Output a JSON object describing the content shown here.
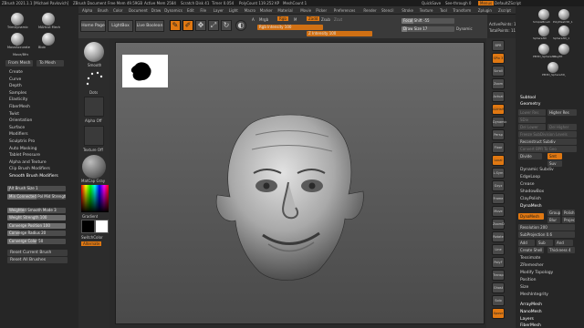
{
  "titlebar": {
    "app": "ZBrush 2021.1.1 [Michael Pavlovich]",
    "doc": "ZBrush Document",
    "mem1": "Free Mem 49.59GB",
    "mem2": "Active Mem 2584",
    "scratch": "Scratch Disk 41",
    "timer": "Timer 0.054",
    "polycount": "PolyCount 119.252 KP",
    "meshcount": "MeshCount 1",
    "quicksave": "QuickSave",
    "seethrough": "See-through 0",
    "menus": "Menus",
    "defaultscript": "DefaultZScript"
  },
  "menubar": [
    "Alpha",
    "Brush",
    "Color",
    "Document",
    "Draw",
    "Dynamics",
    "Edit",
    "File",
    "Layer",
    "Light",
    "Macro",
    "Marker",
    "Material",
    "Movie",
    "Picker",
    "Preferences",
    "Render",
    "Stencil",
    "Stroke",
    "Texture",
    "Tool",
    "Transform",
    "Zplugin",
    "Zscript",
    "Help"
  ],
  "toolbar": {
    "home": "Home Page",
    "lightbox": "LightBox",
    "liveboolean": "Live Boolean",
    "edit": "Edit",
    "draw": "Draw",
    "move": "Move",
    "scale": "Scale",
    "rotate": "Rotate",
    "a_label": "A",
    "mrgb": "Mrgb",
    "rgb": "Rgb",
    "m_label": "M",
    "zadd": "Zadd",
    "zsub": "Zsub",
    "zcut": "Zcut",
    "rgb_intensity": "Rgb Intensity 100",
    "z_intensity": "Z Intensity 100",
    "rgb_intensity_value": 1.0,
    "z_intensity_value": 1.0,
    "focal_shift": "Focal Shift -55",
    "draw_size": "Draw Size 17",
    "dynamic": "Dynamic",
    "focal_shift_value": 0.225,
    "draw_size_value": 0.1,
    "active_points": "ActivePoints: 119",
    "total_points": "TotalPoints: 119"
  },
  "leftpanel": {
    "spheres": [
      {
        "label": "TrimDynamic"
      },
      {
        "label": "MAHcut Mech"
      },
      {
        "label": "MoveAccurate"
      },
      {
        "label": "Blob"
      },
      {
        "label": "Move/Bfrs"
      }
    ],
    "from_mesh": "From Mesh",
    "to_mesh": "To Mesh",
    "items": [
      "Create",
      "Curve",
      "Depth",
      "Samples",
      "Elasticity",
      "FiberMesh",
      "Twist",
      "Orientation",
      "Surface",
      "Modifiers",
      "Sculptris Pro",
      "Auto Masking",
      "Tablet Pressure",
      "Alpha and Texture",
      "Clip Brush Modifiers",
      "Smooth Brush Modifiers"
    ],
    "sliders": [
      {
        "label": "Alt Brush Size 1",
        "value": 0.05
      },
      {
        "label": "Min Connected Pol Mid Strength",
        "value": 0.5
      },
      {
        "label": "Weighted Smooth Mode 3",
        "value": 0.3
      },
      {
        "label": "Weight Strength 100",
        "value": 1.0
      },
      {
        "label": "Converge Position 100",
        "value": 1.0
      },
      {
        "label": "Converge Radius 20",
        "value": 0.2
      },
      {
        "label": "Converge Color 50",
        "value": 0.5
      }
    ],
    "reset_current": "Reset Current Brush",
    "reset_all": "Reset All Brushes"
  },
  "brushcol": {
    "smooth": "Smooth",
    "dots": "Dots",
    "alpha_off": "Alpha Off",
    "texture_off": "Texture Off",
    "matcap": "MatCap Gray",
    "gradient": "Gradient",
    "switchcolor": "SwitchColor",
    "alternate": "Alternate"
  },
  "rightcol": [
    "BPR",
    "SPix 3",
    "Scroll",
    "Zoom",
    "Actual",
    "AAHalf",
    "Dynamic",
    "Persp",
    "Floor",
    "Local",
    "L.Sym",
    "Gxyz",
    "Frame",
    "Move",
    "ZoomD",
    "Rotate",
    "Line Fill",
    "PolyF",
    "Transp",
    "Ghost",
    "Solo",
    "Xpose"
  ],
  "rightpanel": {
    "tools": [
      {
        "label": "SimpleBrush"
      },
      {
        "label": "PolyMesh3D_1"
      },
      {
        "label": "Sphere3D"
      },
      {
        "label": "Sphere3D_1"
      },
      {
        "label": "PM3D_Sphere3D"
      },
      {
        "label": "ClayPit"
      },
      {
        "label": "PM3D_Sphere3D_1"
      }
    ],
    "subtool": "Subtool",
    "geometry": "Geometry",
    "lower_res": "Lower Res",
    "higher_res": "Higher Res",
    "sdiv": "SDiv",
    "del_lower": "Del Lower",
    "del_higher": "Del Higher",
    "freeze": "Freeze SubDivision Levels",
    "reconstruct": "Reconstruct Subdiv",
    "convert": "Convert BPR To Geo",
    "divide": "Divide",
    "smt": "Smt",
    "suv": "Suv",
    "dynamic_subdiv": "Dynamic Subdiv",
    "edgeloop": "EdgeLoop",
    "crease": "Crease",
    "shadowbox": "ShadowBox",
    "claypolish": "ClayPolish",
    "dynamesh_header": "DynaMesh",
    "dynamesh": "DynaMesh",
    "groups": "Groups",
    "polish": "Polish",
    "blur": "Blur",
    "project": "Project",
    "resolution": "Resolution 200",
    "subprojection": "SubProjection 0.6",
    "add": "Add",
    "sub": "Sub",
    "and": "And",
    "create_shell": "Create Shell",
    "thickness": "Thickness 4",
    "tessimate": "Tessimate",
    "zremesher": "ZRemesher",
    "modify_topology": "Modify Topology",
    "position": "Position",
    "size": "Size",
    "meshintegrity": "MeshIntegrity",
    "arraymesh": "ArrayMesh",
    "nanomesh": "NanoMesh",
    "layers": "Layers",
    "fibermesh": "FiberMesh"
  },
  "colors": {
    "accent": "#e07812",
    "panel": "#262626",
    "canvas_top": "#6a6a6a",
    "canvas_bottom": "#4a4a4a"
  }
}
